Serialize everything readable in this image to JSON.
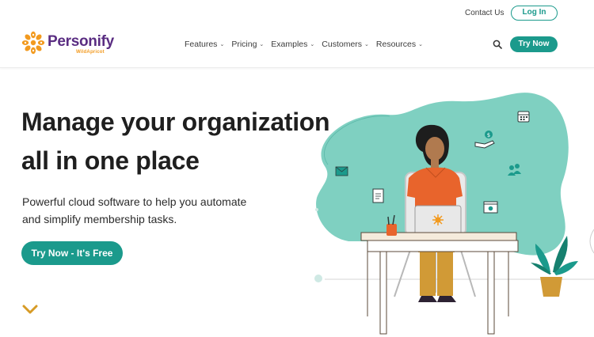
{
  "header": {
    "contact_label": "Contact Us",
    "login_label": "Log In",
    "logo_name": "Personify",
    "logo_sub": "WildApricot",
    "nav": [
      {
        "label": "Features"
      },
      {
        "label": "Pricing"
      },
      {
        "label": "Examples"
      },
      {
        "label": "Customers"
      },
      {
        "label": "Resources"
      }
    ],
    "try_label": "Try Now"
  },
  "hero": {
    "title_line1": "Manage your organization",
    "title_line2": "all in one place",
    "subtitle_line1": "Powerful cloud software to help you automate",
    "subtitle_line2": "and simplify membership tasks.",
    "cta_label": "Try Now - It's Free"
  },
  "colors": {
    "brand_teal": "#1b9a8c",
    "brand_purple": "#5a2d82",
    "brand_orange": "#f29a1f",
    "blob": "#7fd0c1"
  },
  "icons": [
    "sun-logo-icon",
    "chevron-down-icon",
    "search-icon",
    "calendar-icon",
    "money-hand-icon",
    "email-icon",
    "people-icon",
    "document-icon",
    "gear-window-icon"
  ]
}
